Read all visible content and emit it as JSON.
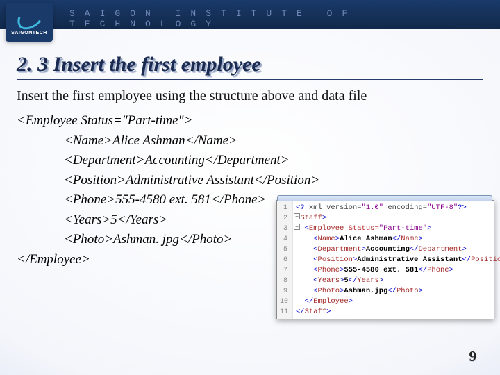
{
  "header": {
    "logo_label": "SAIGONTECH",
    "institute_line": "SAIGON INSTITUTE OF TECHNOLOGY"
  },
  "title": "2. 3 Insert the first employee",
  "description": "Insert the first employee using the structure above and data file",
  "xml": {
    "open": "<Employee Status=\"Part-time\">",
    "name": "<Name>Alice Ashman</Name>",
    "dept": "<Department>Accounting</Department>",
    "pos": "<Position>Administrative Assistant</Position>",
    "phone": "<Phone>555-4580 ext. 581</Phone>",
    "years": "<Years>5</Years>",
    "photo": "<Photo>Ashman. jpg</Photo>",
    "close": "</Employee>"
  },
  "editor": {
    "lines": [
      "1",
      "2",
      "3",
      "4",
      "5",
      "6",
      "7",
      "8",
      "9",
      "10",
      "11"
    ],
    "code": {
      "l1a": "<?",
      "l1b": " xml version=",
      "l1c": "\"1.0\"",
      "l1d": " encoding=",
      "l1e": "\"UTF-8\"",
      "l1f": "?>",
      "l2o": "<",
      "l2t": "Staff",
      "l2c": ">",
      "l3o": "<",
      "l3t": "Employee",
      "l3a": " Status=",
      "l3v": "\"Part-time\"",
      "l3c": ">",
      "l4o": "<",
      "l4t": "Name",
      "l4c": ">",
      "l4x": "Alice Ashman",
      "l4k": "</",
      "l4e": ">",
      "l5o": "<",
      "l5t": "Department",
      "l5c": ">",
      "l5x": "Accounting",
      "l5k": "</",
      "l5e": ">",
      "l6o": "<",
      "l6t": "Position",
      "l6c": ">",
      "l6x": "Administrative Assistant",
      "l6k": "</",
      "l6e": ">",
      "l7o": "<",
      "l7t": "Phone",
      "l7c": ">",
      "l7x": "555-4580 ext. 581",
      "l7k": "</",
      "l7e": ">",
      "l8o": "<",
      "l8t": "Years",
      "l8c": ">",
      "l8x": "5",
      "l8k": "</",
      "l8e": ">",
      "l9o": "<",
      "l9t": "Photo",
      "l9c": ">",
      "l9x": "Ashman.jpg",
      "l9k": "</",
      "l9e": ">",
      "l10k": "</",
      "l10t": "Employee",
      "l10e": ">",
      "l11k": "</",
      "l11t": "Staff",
      "l11e": ">"
    }
  },
  "page_number": "9"
}
